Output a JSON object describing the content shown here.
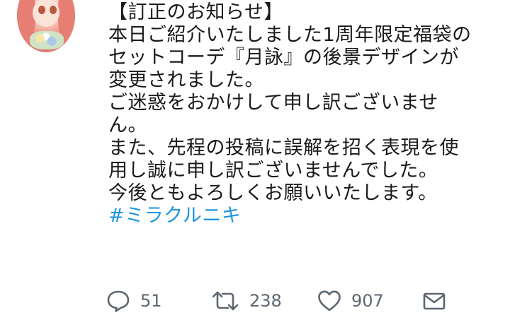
{
  "tweet": {
    "lines": [
      "【訂正のお知らせ】",
      "本日ご紹介いたしました1周年限定福袋の",
      "セットコーデ『月詠』の後景デザインが",
      "変更されました。",
      "ご迷惑をおかけして申し訳ございませ",
      "ん。",
      "また、先程の投稿に誤解を招く表現を使",
      "用し誠に申し訳ございませんでした。",
      "今後ともよろしくお願いいたします。"
    ],
    "hashtag": "#ミラクルニキ"
  },
  "actions": {
    "reply": {
      "icon": "reply-icon",
      "count": "51"
    },
    "retweet": {
      "icon": "retweet-icon",
      "count": "238"
    },
    "like": {
      "icon": "heart-icon",
      "count": "907"
    },
    "message": {
      "icon": "envelope-icon"
    }
  },
  "colors": {
    "text": "#1a1a1a",
    "hashtag": "#1b95e0",
    "action_gray": "#5c6670"
  }
}
